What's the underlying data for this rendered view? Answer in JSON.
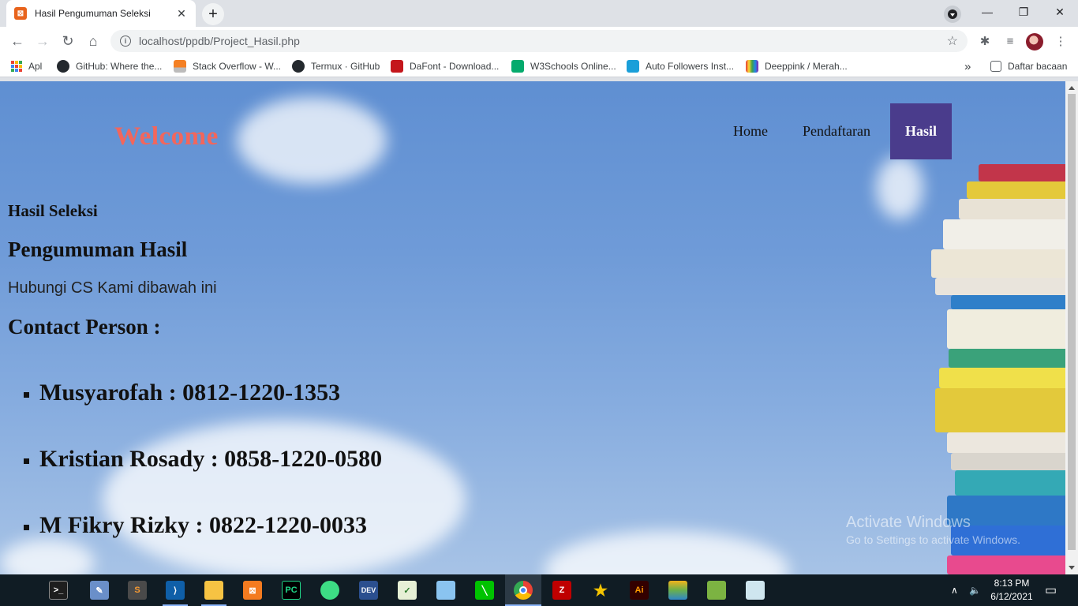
{
  "browser": {
    "tab_title": "Hasil Pengumuman Seleksi",
    "tab_close": "✕",
    "new_tab": "+",
    "url": "localhost/ppdb/Project_Hasil.php",
    "window_buttons": {
      "minimize": "—",
      "restore": "❐",
      "close": "✕"
    },
    "bookmarks": [
      {
        "label": "Apl"
      },
      {
        "label": "GitHub: Where the..."
      },
      {
        "label": "Stack Overflow - W..."
      },
      {
        "label": "Termux · GitHub"
      },
      {
        "label": "DaFont - Download..."
      },
      {
        "label": "W3Schools Online..."
      },
      {
        "label": "Auto Followers Inst..."
      },
      {
        "label": "Deeppink / Merah..."
      }
    ],
    "bookmarks_more": "»",
    "reading_list": "Daftar bacaan"
  },
  "page": {
    "logo": "Welcome",
    "nav": [
      {
        "label": "Home"
      },
      {
        "label": "Pendaftaran"
      },
      {
        "label": "Hasil",
        "active": true
      }
    ],
    "heading_seleksi": "Hasil Seleksi",
    "heading_pengumuman": "Pengumuman Hasil",
    "info_text": "Hubungi CS Kami dibawah ini",
    "heading_contact": "Contact Person :",
    "contacts": [
      {
        "text": "Musyarofah : 0812-1220-1353"
      },
      {
        "text": "Kristian Rosady : 0858-1220-0580"
      },
      {
        "text": "M Fikry Rizky : 0822-1220-0033"
      }
    ],
    "watermark_line1": "Activate Windows",
    "watermark_line2": "Go to Settings to activate Windows."
  },
  "taskbar": {
    "time": "8:13 PM",
    "date": "6/12/2021",
    "apps": [
      "terminal-icon",
      "paint-icon",
      "sublime-icon",
      "vscode-icon",
      "explorer-icon",
      "xampp-icon",
      "pycharm-icon",
      "android-studio-icon",
      "devcpp-icon",
      "notepad-icon",
      "virtualbox-icon",
      "line-icon",
      "chrome-icon",
      "filezilla-icon",
      "star-app-icon",
      "illustrator-icon",
      "bluestacks-icon",
      "android-icon",
      "pen-app-icon"
    ]
  },
  "colors": {
    "logo": "#f2665c",
    "nav_active_bg": "#4a3c8c",
    "sky": "#6f9bd8"
  }
}
